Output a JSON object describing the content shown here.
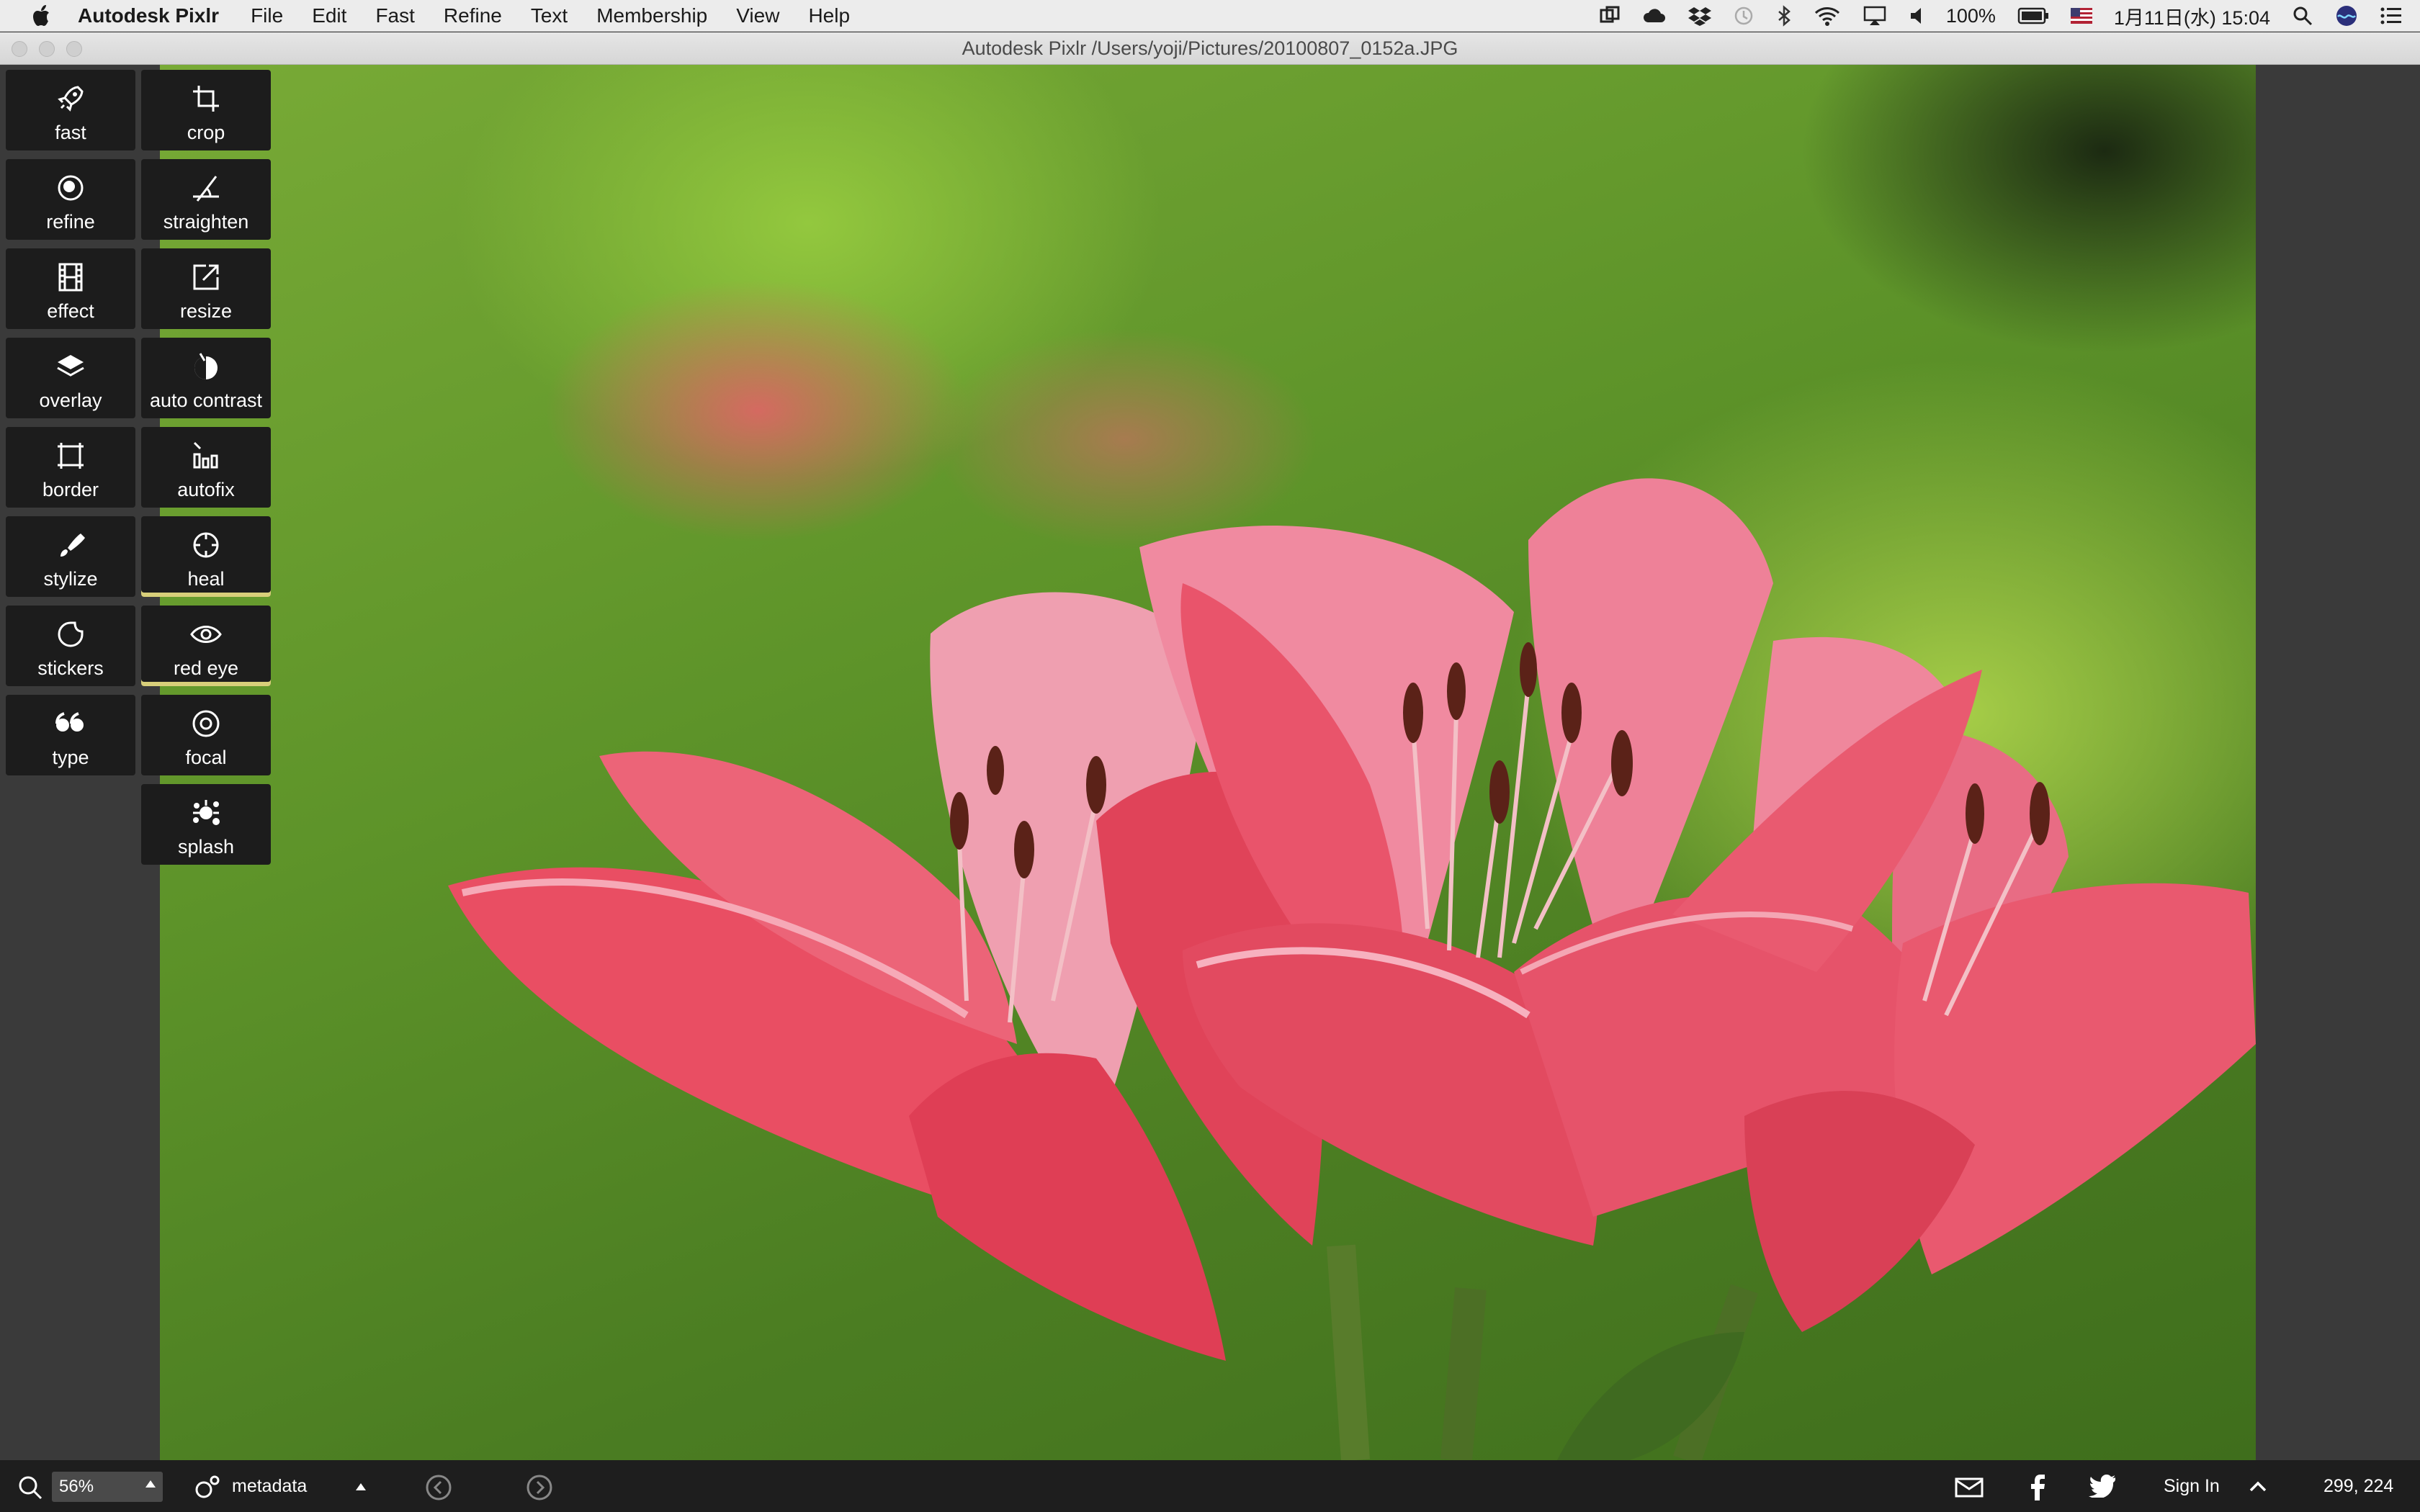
{
  "menubar": {
    "app_name": "Autodesk Pixlr",
    "items": [
      "File",
      "Edit",
      "Fast",
      "Refine",
      "Text",
      "Membership",
      "View",
      "Help"
    ],
    "battery": "100%",
    "clock": "1月11日(水) 15:04"
  },
  "window": {
    "title": "Autodesk Pixlr   /Users/yoji/Pictures/20100807_0152a.JPG"
  },
  "tools": {
    "left": [
      {
        "label": "fast",
        "icon": "rocket-icon"
      },
      {
        "label": "refine",
        "icon": "refine-icon"
      },
      {
        "label": "effect",
        "icon": "film-icon"
      },
      {
        "label": "overlay",
        "icon": "layers-icon"
      },
      {
        "label": "border",
        "icon": "border-icon"
      },
      {
        "label": "stylize",
        "icon": "brush-icon"
      },
      {
        "label": "stickers",
        "icon": "sticker-icon"
      },
      {
        "label": "type",
        "icon": "quote-icon"
      }
    ],
    "right": [
      {
        "label": "crop",
        "icon": "crop-icon"
      },
      {
        "label": "straighten",
        "icon": "straighten-icon"
      },
      {
        "label": "resize",
        "icon": "resize-icon"
      },
      {
        "label": "auto contrast",
        "icon": "contrast-icon"
      },
      {
        "label": "autofix",
        "icon": "autofix-icon"
      },
      {
        "label": "heal",
        "icon": "heal-icon"
      },
      {
        "label": "red eye",
        "icon": "eye-icon"
      },
      {
        "label": "focal",
        "icon": "focal-icon"
      },
      {
        "label": "splash",
        "icon": "splash-icon"
      }
    ]
  },
  "bottom": {
    "zoom": "56%",
    "metadata_label": "metadata",
    "sign_in": "Sign In",
    "coords": "299, 224"
  },
  "colors": {
    "toolbar_bg": "#1c1c1c",
    "active_accent": "#d8cf7a",
    "workspace_bg": "#3a3a3a",
    "bottombar_bg": "#1e1e1e"
  }
}
